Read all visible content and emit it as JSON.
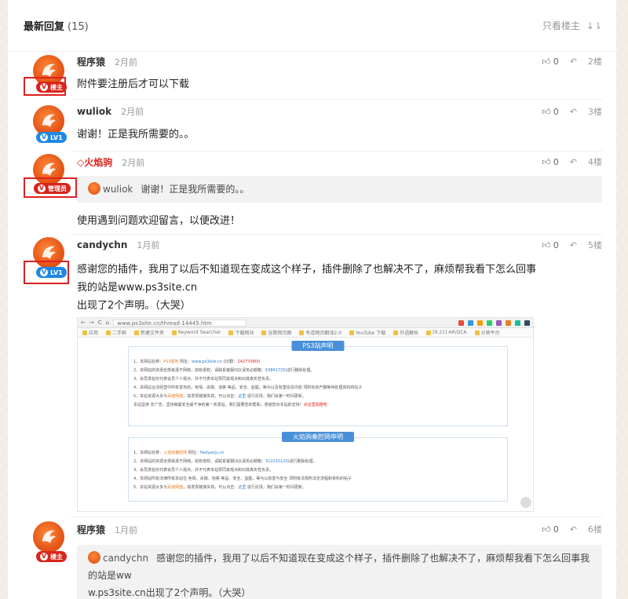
{
  "header": {
    "title": "最新回复",
    "count": "(15)",
    "only_op": "只看楼主",
    "sort_icon": "↓⇂"
  },
  "badges": {
    "op": "楼主",
    "admin": "管理员",
    "lv1": "LV1",
    "v": "V"
  },
  "replies": [
    {
      "user": "程序猿",
      "time": "2月前",
      "likes": "0",
      "floor": "2楼",
      "content": "附件要注册后才可以下载"
    },
    {
      "user": "wuliok",
      "time": "2月前",
      "likes": "0",
      "floor": "3楼",
      "content": "谢谢！正是我所需要的。。"
    },
    {
      "user": "火焰驹",
      "time": "2月前",
      "likes": "0",
      "floor": "4楼",
      "quote_user": "wuliok",
      "quote_text": "谢谢！正是我所需要的。。",
      "content": "使用遇到问题欢迎留言，以便改进！"
    },
    {
      "user": "candychn",
      "time": "1月前",
      "likes": "0",
      "floor": "5楼",
      "lines": [
        "感谢您的插件，我用了以后不知道现在变成这个样子，插件删除了也解决不了，麻烦帮我看下怎么回事",
        "我的站是www.ps3site.cn",
        "出现了2个声明。（大哭）"
      ]
    },
    {
      "user": "程序猿",
      "time": "1月前",
      "likes": "0",
      "floor": "6楼",
      "quote_user": "candychn",
      "quote_lines": [
        "感谢您的插件，我用了以后不知道现在变成这个样子，插件删除了也解决不了，麻烦帮我看下怎么回事我的站是ww",
        "w.ps3site.cn出现了2个声明。（大哭）"
      ]
    }
  ],
  "screenshot": {
    "url": "www.ps3site.cn/thread-14445.htm",
    "bookmarks": [
      "应用",
      "二手群",
      "新建文件夹",
      "Keyword Searcher",
      "下载网站",
      "谷歌网页图",
      "有道网页翻译2.0",
      "YouTube 下载",
      "外语解析",
      "[9.21] AR/QCA",
      "分销平台"
    ],
    "notice1": {
      "title": "PS3站声明",
      "lines": [
        [
          "1、本网站名称：",
          "PS3基地",
          " 网址：",
          "www.ps3site.cn",
          " QQ群：",
          "242770800"
        ],
        [
          "2、本网站的资源全部来源于网络，如有侵权，请联系客服QQ(请务必邮箱：",
          "63841725",
          ")进行删除处理。"
        ],
        [
          "3、会员发帖仅代表会员个人观点，并不代表本站赞同其观点和对其真实性负责。"
        ],
        [
          "4、本网站合法经营中所有发布的，色情、杀戮、违禁 等品、安全、血腥，等为以及有害信息内容 须附有资产删等待处理资料的帖子"
        ],
        [
          "5、本站资源大多为",
          "百度网盘",
          "，如发现链接失效，可以点击：",
          "这里",
          " 进行反馈，我们会第一时间更新。"
        ],
        [
          "本站坚持",
          " 非广告，坚持做最安全最干净的第一资源站，我们需要您的帮助，感谢您对本站的支持！",
          "点这里捐赠吧"
        ]
      ]
    },
    "notice2": {
      "title": "火焰驹秦腔网申明",
      "lines": [
        [
          "1、本网站名称：",
          "火焰驹秦腔网",
          " 网址：",
          "fiedyanju.cn"
        ],
        [
          "2、本网站的资源全部来源于网络，如有侵权，请联系客服QQ(请务必邮箱：",
          "312215120",
          ")进行删除处理。"
        ],
        [
          "3、会员发帖仅代表会员个人观点，并不代表本站赞同其观点和对其真实性负责。"
        ],
        [
          "4、本网站所有法律所有本站在 色情、杀戮、违禁 等品、安全、血腥，等为以有害与安全 须附有法规所法定流程和资料的帖子"
        ],
        [
          "5、本站资源大多为",
          "百度网盘",
          "，如发现链接失效，可以点击：",
          "这里",
          " 进行反馈，我们会第一时间更新。"
        ]
      ]
    }
  },
  "colors": {
    "accent_red": "#d9241b",
    "badge_blue": "#1e88e5",
    "highlight_box": "#e02020"
  }
}
